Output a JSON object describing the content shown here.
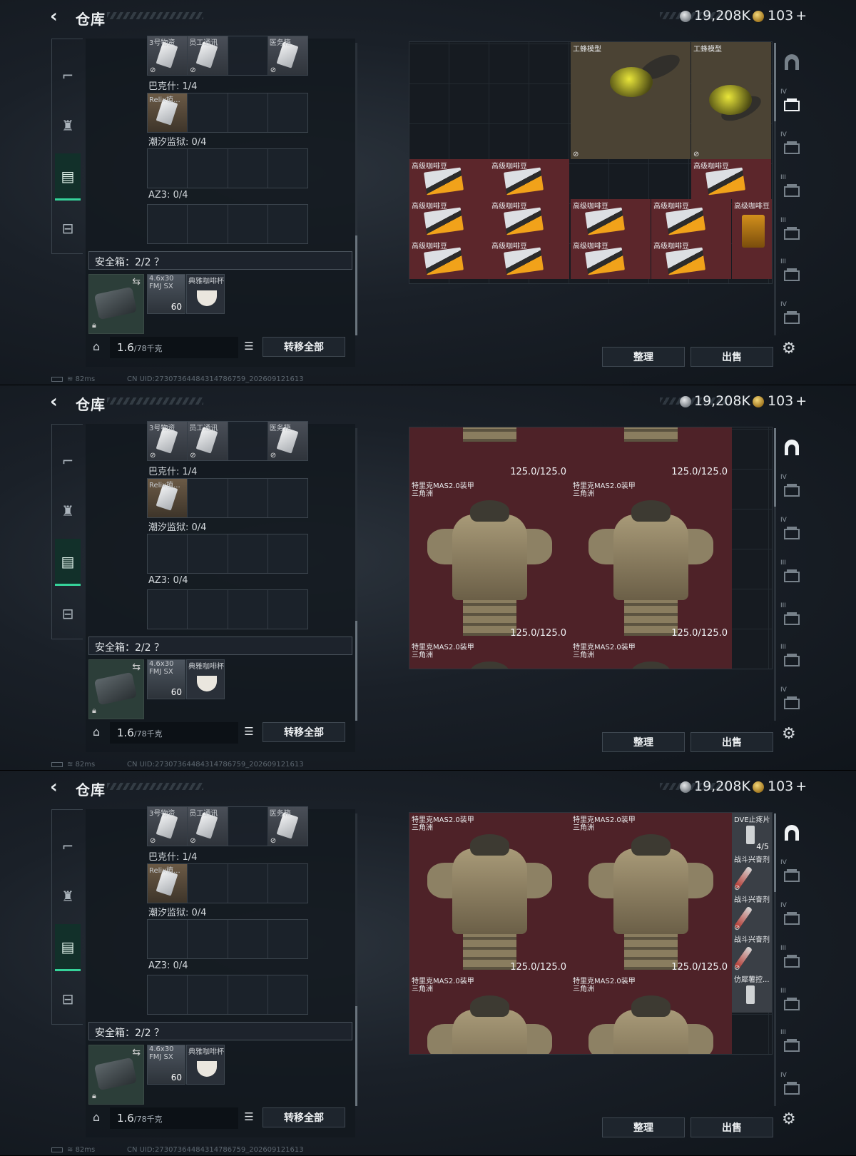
{
  "header": {
    "title": "仓库",
    "currency_1": "19,208K",
    "currency_2": "103",
    "add_symbol": "+"
  },
  "left": {
    "top_row_items": [
      "3号物资",
      "员工通讯",
      "",
      "医务箱"
    ],
    "section_bakeshi": "巴克什: 1/4",
    "relic_item": "Relix植...",
    "section_chaoxi": "潮汐监狱: 0/4",
    "section_az3": "AZ3: 0/4",
    "safe_header": "安全箱：2/2 ？",
    "ammo_name": "4.6x30",
    "ammo_sub": "FMJ SX",
    "ammo_count": "60",
    "cup_name": "典雅咖啡杯",
    "weight_value": "1.6",
    "weight_max": "/78千克",
    "transfer_label": "转移全部"
  },
  "actions": {
    "sort_label": "整理",
    "sell_label": "出售"
  },
  "status": {
    "ping": "82ms",
    "uid": "CN UID:27307364484314786759_202609121613"
  },
  "stash_1": {
    "bee_label": "工蜂模型",
    "coffee_label": "高级咖啡豆"
  },
  "stash_armor": {
    "armor_name": "特里克MAS2.0装甲",
    "armor_map": "三角洲",
    "durability": "125.0/125.0",
    "dve_label": "DVE止疼片",
    "dve_count": "4/5",
    "stim_label": "战斗兴奋剂",
    "other_label": "仿犀薯控..."
  },
  "tab_numbers": [
    "IV",
    "IV",
    "III",
    "III",
    "III",
    "IV"
  ]
}
